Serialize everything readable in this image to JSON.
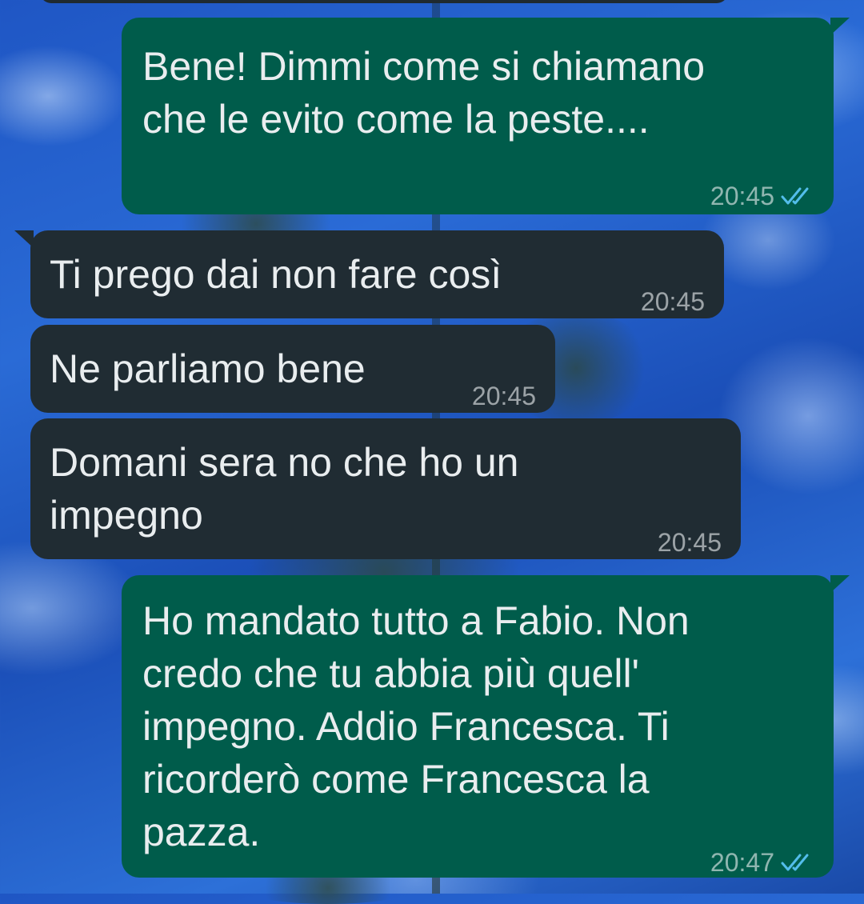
{
  "messages": [
    {
      "direction": "outgoing",
      "text": "Bene! Dimmi come si chiamano\nche le evito come la peste....",
      "time": "20:45",
      "status_icon": "double-check-read-icon"
    },
    {
      "direction": "incoming",
      "text": "Ti prego dai non fare così",
      "time": "20:45"
    },
    {
      "direction": "incoming",
      "text": "Ne parliamo bene",
      "time": "20:45"
    },
    {
      "direction": "incoming",
      "text": "Domani sera no che ho un\nimpegno",
      "time": "20:45"
    },
    {
      "direction": "outgoing",
      "text": "Ho mandato tutto a Fabio. Non\ncredo che tu abbia più quell'\nimpegno. Addio Francesca. Ti\nricorderò come Francesca la\npazza.",
      "time": "20:47",
      "status_icon": "double-check-read-icon"
    }
  ],
  "colors": {
    "outgoing_bubble": "#005c4b",
    "incoming_bubble": "#202c33",
    "message_text": "#e9edef",
    "read_ticks": "#53bdeb",
    "wallpaper": "#2a6bd6"
  }
}
